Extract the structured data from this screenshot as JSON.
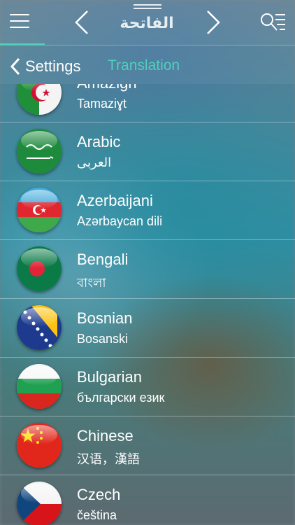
{
  "topbar": {
    "title": "الفاتحة",
    "menu_icon": "hamburger-icon",
    "prev_icon": "chevron-left-icon",
    "next_icon": "chevron-right-icon",
    "search_icon": "search-list-icon"
  },
  "subbar": {
    "back_label": "Settings",
    "title": "Translation"
  },
  "colors": {
    "accent": "#4ed1b9"
  },
  "languages": [
    {
      "name": "Amazigh",
      "native": "Tamaziɣt",
      "flag": "algeria"
    },
    {
      "name": "Arabic",
      "native": "العربی",
      "flag": "saudi-arabia"
    },
    {
      "name": "Azerbaijani",
      "native": "Azərbaycan dili",
      "flag": "azerbaijan"
    },
    {
      "name": "Bengali",
      "native": "বাংলা",
      "flag": "bangladesh"
    },
    {
      "name": "Bosnian",
      "native": "Bosanski",
      "flag": "bosnia"
    },
    {
      "name": "Bulgarian",
      "native": "български език",
      "flag": "bulgaria"
    },
    {
      "name": "Chinese",
      "native": "汉语，漢語",
      "flag": "china"
    },
    {
      "name": "Czech",
      "native": "čeština",
      "flag": "czech"
    }
  ]
}
